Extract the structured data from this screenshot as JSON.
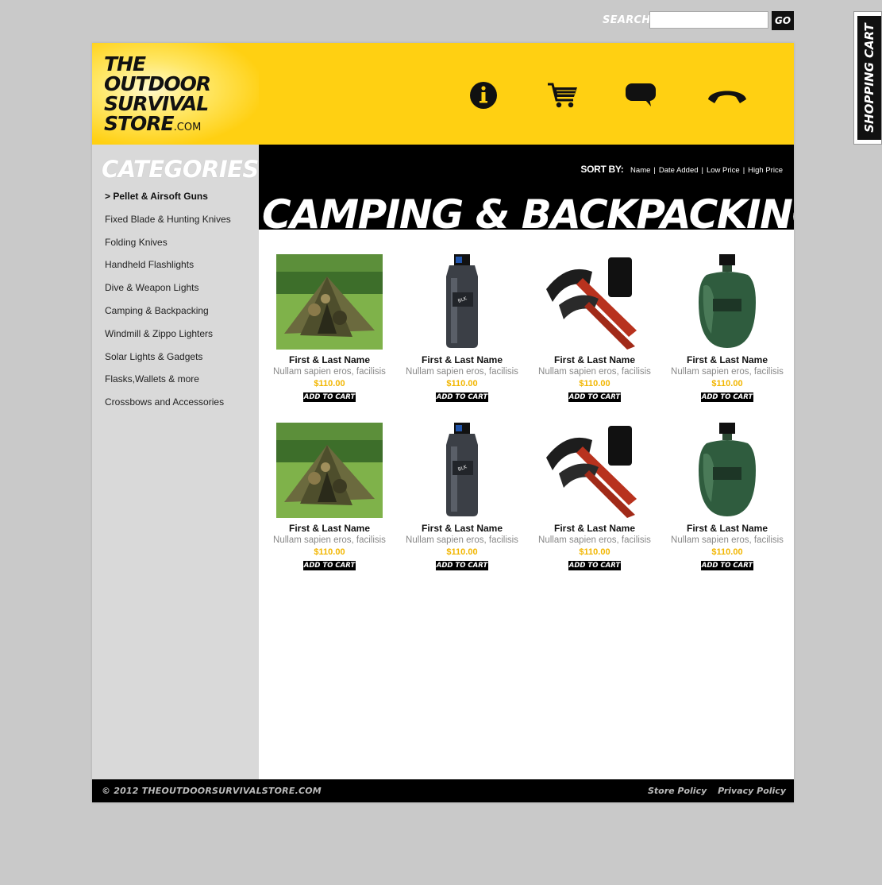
{
  "search": {
    "label": "SEARCH",
    "placeholder": "",
    "value": "",
    "go_label": "GO"
  },
  "cart_tab": {
    "label": "SHOPPING CART"
  },
  "logo": {
    "line1": "THE",
    "line2": "OUTDOOR",
    "line3": "SURVIVAL",
    "line4": "STORE",
    "suffix": ".COM"
  },
  "header_icons": [
    "info-icon",
    "cart-icon",
    "chat-bubble-icon",
    "phone-icon"
  ],
  "colors": {
    "brand_yellow": "#ffd012",
    "price_yellow": "#f2b600",
    "sidebar_gray": "#d9d9d9",
    "black": "#000000"
  },
  "sidebar": {
    "title": "CATEGORIES",
    "items": [
      {
        "label": "> Pellet & Airsoft Guns"
      },
      {
        "label": "Fixed Blade & Hunting Knives"
      },
      {
        "label": "Folding Knives"
      },
      {
        "label": "Handheld Flashlights"
      },
      {
        "label": "Dive & Weapon Lights"
      },
      {
        "label": "Camping & Backpacking"
      },
      {
        "label": "Windmill & Zippo Lighters"
      },
      {
        "label": "Solar Lights & Gadgets"
      },
      {
        "label": "Flasks,Wallets & more"
      },
      {
        "label": "Crossbows and Accessories"
      }
    ]
  },
  "sort": {
    "label": "SORT BY:",
    "options": [
      "Name",
      "Date Added",
      "Low Price",
      "High Price"
    ],
    "separator": "|"
  },
  "main": {
    "title": "CAMPING & BACKPACKING"
  },
  "products": [
    {
      "name": "First & Last Name",
      "desc": "Nullam sapien eros, facilisis",
      "price": "$110.00",
      "button": "ADD TO CART",
      "image": "tent"
    },
    {
      "name": "First & Last Name",
      "desc": "Nullam sapien eros, facilisis",
      "price": "$110.00",
      "button": "ADD TO CART",
      "image": "bottle"
    },
    {
      "name": "First & Last Name",
      "desc": "Nullam sapien eros, facilisis",
      "price": "$110.00",
      "button": "ADD TO CART",
      "image": "axe"
    },
    {
      "name": "First & Last Name",
      "desc": "Nullam sapien eros, facilisis",
      "price": "$110.00",
      "button": "ADD TO CART",
      "image": "canteen"
    },
    {
      "name": "First & Last Name",
      "desc": "Nullam sapien eros, facilisis",
      "price": "$110.00",
      "button": "ADD TO CART",
      "image": "tent"
    },
    {
      "name": "First & Last Name",
      "desc": "Nullam sapien eros, facilisis",
      "price": "$110.00",
      "button": "ADD TO CART",
      "image": "bottle"
    },
    {
      "name": "First & Last Name",
      "desc": "Nullam sapien eros, facilisis",
      "price": "$110.00",
      "button": "ADD TO CART",
      "image": "axe"
    },
    {
      "name": "First & Last Name",
      "desc": "Nullam sapien eros, facilisis",
      "price": "$110.00",
      "button": "ADD TO CART",
      "image": "canteen"
    }
  ],
  "footer": {
    "copyright": "© 2012 THEOUTDOORSURVIVALSTORE.COM",
    "links": [
      "Store Policy",
      "Privacy Policy"
    ]
  }
}
